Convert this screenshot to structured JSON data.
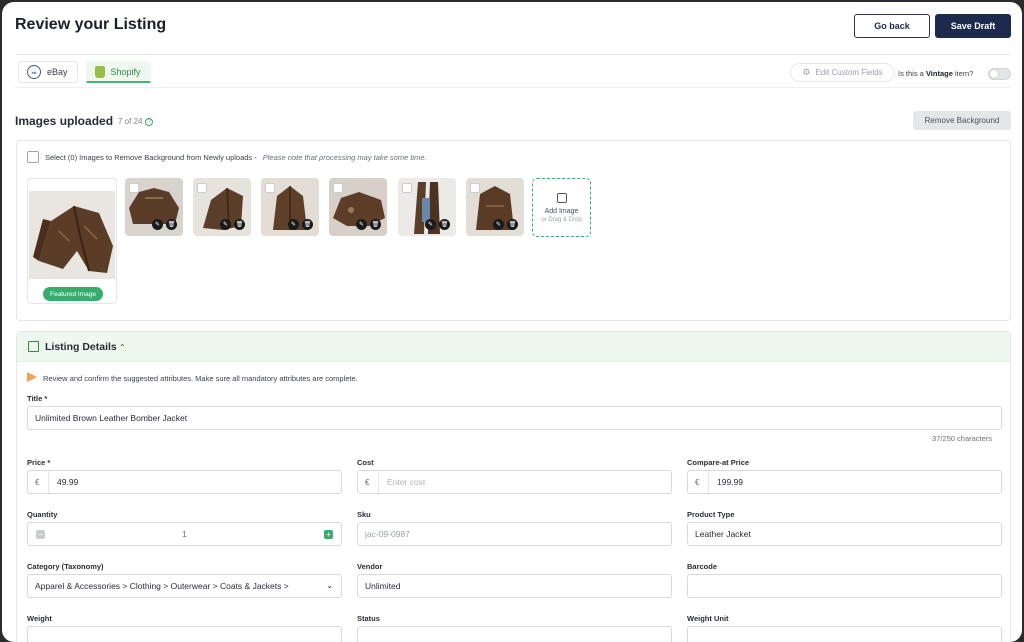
{
  "header": {
    "title": "Review your Listing",
    "go_back": "Go back",
    "save_draft": "Save Draft"
  },
  "tabs": [
    {
      "label": "eBay",
      "logo": "ebay"
    },
    {
      "label": "Shopify",
      "logo": "shopify",
      "active": true
    }
  ],
  "toolbar": {
    "edit_custom_fields": "Edit Custom Fields",
    "vintage_prefix": "Is this a",
    "vintage_bold": "Vintage",
    "vintage_suffix": "item?",
    "vintage_on": false
  },
  "images": {
    "title": "Images uploaded",
    "count": "7 of 24",
    "remove_background": "Remove Background",
    "select_text": "Select (0) Images to Remove Background from Newly uploads -",
    "select_note": "Please note that processing may take some time.",
    "featured_label": "Featured Image",
    "add_image": "Add Image",
    "drag_drop": "or Drag & Drop"
  },
  "details": {
    "title": "Listing Details",
    "notice": "Review and confirm the suggested attributes. Make sure all mandatory attributes are complete.",
    "fields": {
      "title_label": "Title *",
      "title_value": "Unlimited Brown Leather Bomber Jacket",
      "char_count": "37/250 characters",
      "price_label": "Price *",
      "price_currency": "€",
      "price_value": "49.99",
      "cost_label": "Cost",
      "cost_currency": "€",
      "cost_placeholder": "Enter cost",
      "compare_label": "Compare-at Price",
      "compare_currency": "€",
      "compare_value": "199.99",
      "quantity_label": "Quantity",
      "quantity_value": "1",
      "sku_label": "Sku",
      "sku_value": "jac-09-0987",
      "product_type_label": "Product Type",
      "product_type_value": "Leather Jacket",
      "category_label": "Category (Taxonomy)",
      "category_value": "Apparel & Accessories > Clothing > Outerwear > Coats & Jackets >",
      "vendor_label": "Vendor",
      "vendor_value": "Unlimited",
      "barcode_label": "Barcode",
      "barcode_value": "",
      "weight_label": "Weight",
      "status_label": "Status",
      "weight_unit_label": "Weight Unit"
    }
  }
}
